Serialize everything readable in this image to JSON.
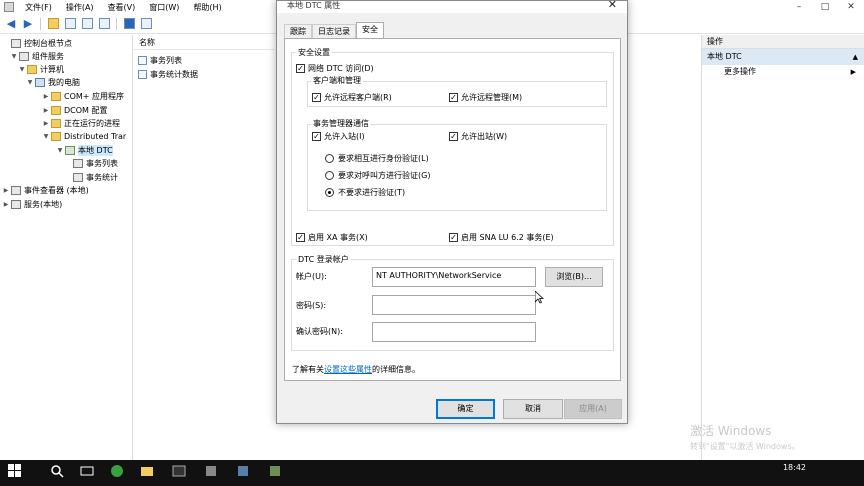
{
  "menubar": {
    "items": [
      "文件(F)",
      "操作(A)",
      "查看(V)",
      "窗口(W)",
      "帮助(H)"
    ],
    "window_controls": [
      "–",
      "□",
      "✕"
    ]
  },
  "tree": {
    "items": [
      {
        "label": "控制台根节点",
        "level": 0
      },
      {
        "label": "组件服务",
        "level": 1
      },
      {
        "label": "计算机",
        "level": 2
      },
      {
        "label": "我的电脑",
        "level": 3
      },
      {
        "label": "COM+ 应用程序",
        "level": 4
      },
      {
        "label": "DCOM 配置",
        "level": 4
      },
      {
        "label": "正在运行的进程",
        "level": 4
      },
      {
        "label": "Distributed Trar",
        "level": 4
      },
      {
        "label": "本地 DTC",
        "level": 5
      },
      {
        "label": "事务列表",
        "level": 6
      },
      {
        "label": "事务统计",
        "level": 6
      },
      {
        "label": "事件查看器 (本地)",
        "level": 0
      },
      {
        "label": "服务(本地)",
        "level": 0
      }
    ]
  },
  "names": {
    "header": "名称",
    "items": [
      "事务列表",
      "事务统计数据"
    ]
  },
  "actions": {
    "header": "操作",
    "section": "本地 DTC",
    "items": [
      "更多操作"
    ]
  },
  "dialog": {
    "title": "本地 DTC 属性",
    "close": "✕",
    "tabs": [
      "跟踪",
      "日志记录",
      "安全"
    ],
    "active_tab": "安全",
    "security_group": "安全设置",
    "network_dtc_access": "网络 DTC 访问(D)",
    "client_admin_group": "客户端和管理",
    "allow_remote_clients": "允许远程客户端(R)",
    "allow_remote_admin": "允许远程管理(M)",
    "tm_comm_group": "事务管理器通信",
    "allow_inbound": "允许入站(I)",
    "allow_outbound": "允许出站(W)",
    "auth_mutual": "要求相互进行身份验证(L)",
    "auth_caller": "要求对呼叫方进行验证(G)",
    "auth_none": "不要求进行验证(T)",
    "enable_xa": "启用 XA 事务(X)",
    "enable_sna": "启用 SNA LU 6.2 事务(E)",
    "logon_group": "DTC 登录帐户",
    "account_label": "帐户(U):",
    "account_value": "NT AUTHORITY\\NetworkService",
    "browse": "浏览(B)...",
    "password_label": "密码(S):",
    "confirm_label": "确认密码(N):",
    "info_prefix": "了解有关",
    "info_link": "设置这些属性",
    "info_suffix": "的详细信息。",
    "ok": "确定",
    "cancel": "取消",
    "apply": "应用(A)"
  },
  "watermark": {
    "line1": "激活 Windows",
    "line2": "转到\"设置\"以激活 Windows。"
  },
  "taskbar": {
    "time": "18:42"
  }
}
